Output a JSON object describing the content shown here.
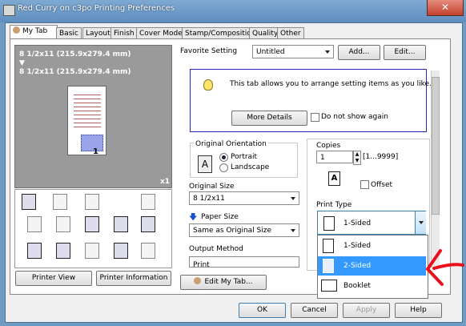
{
  "window": {
    "title": "Red Curry on c3po Printing Preferences",
    "close_symbol": "✕"
  },
  "tabs": [
    "My Tab",
    "Basic",
    "Layout",
    "Finish",
    "Cover Mode",
    "Stamp/Composition",
    "Quality",
    "Other"
  ],
  "preview": {
    "size_line1": "8 1/2x11 (215.9x279.4 mm)",
    "arrow": "▼",
    "size_line2": "8 1/2x11 (215.9x279.4 mm)",
    "page_number": "1",
    "copies_badge": "x1"
  },
  "buttons": {
    "printer_view": "Printer View",
    "printer_information": "Printer Information",
    "edit_my_tab": "Edit My Tab...",
    "add": "Add...",
    "edit": "Edit...",
    "more_details": "More Details",
    "ok": "OK",
    "cancel": "Cancel",
    "apply": "Apply",
    "help": "Help"
  },
  "favorite": {
    "label": "Favorite Setting",
    "value": "Untitled"
  },
  "info": {
    "message": "This tab allows you to arrange setting items as you like.",
    "dont_show": "Do not show again"
  },
  "orientation": {
    "label": "Original Orientation",
    "portrait": "Portrait",
    "landscape": "Landscape",
    "selected": "Portrait",
    "icon_letter": "A"
  },
  "original_size": {
    "label": "Original Size",
    "value": "8 1/2x11"
  },
  "paper_size": {
    "label": "Paper Size",
    "value": "Same as Original Size"
  },
  "output_method": {
    "label": "Output Method",
    "value": "Print"
  },
  "copies": {
    "label": "Copies",
    "value": "1",
    "range": "[1...9999]",
    "offset_label": "Offset"
  },
  "print_type": {
    "label": "Print Type",
    "value": "1-Sided",
    "options": [
      "1-Sided",
      "2-Sided",
      "Booklet"
    ],
    "highlighted": "2-Sided"
  },
  "colors": {
    "highlight": "#3399ff",
    "annotation_arrow": "#e8101a",
    "info_border": "#2525c8"
  }
}
